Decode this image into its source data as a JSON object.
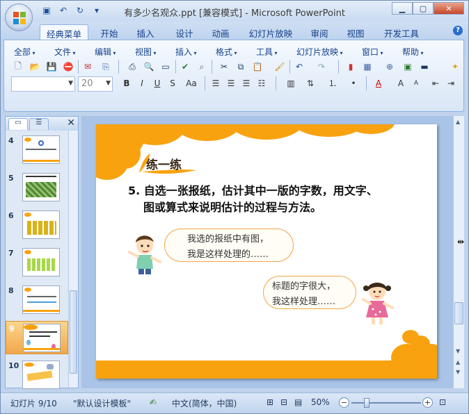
{
  "window": {
    "title": "有多少名观众.ppt [兼容模式] - Microsoft PowerPoint"
  },
  "ribbon_tabs": [
    "经典菜单",
    "开始",
    "插入",
    "设计",
    "动画",
    "幻灯片放映",
    "审阅",
    "视图",
    "开发工具"
  ],
  "menus": [
    "全部",
    "文件",
    "编辑",
    "视图",
    "插入",
    "格式",
    "工具",
    "幻灯片放映",
    "窗口",
    "帮助"
  ],
  "font": {
    "name_value": "",
    "size_value": "20"
  },
  "slides_pane": {
    "slides": [
      {
        "num": "4",
        "selected": false
      },
      {
        "num": "5",
        "selected": false
      },
      {
        "num": "6",
        "selected": false
      },
      {
        "num": "7",
        "selected": false
      },
      {
        "num": "8",
        "selected": false
      },
      {
        "num": "9",
        "selected": true
      },
      {
        "num": "10",
        "selected": false
      }
    ]
  },
  "slide": {
    "heading": "练一练",
    "question_line1": "5. 自选一张报纸，估计其中一版的字数，用文字、",
    "question_line2": "图或算式来说明估计的过程与方法。",
    "bubble1_line1": "我选的报纸中有图，",
    "bubble1_line2": "我是这样处理的……",
    "bubble2_line1": "标题的字很大，",
    "bubble2_line2": "我这样处理……"
  },
  "status": {
    "slide_pos": "幻灯片 9/10",
    "template": "\"默认设计模板\"",
    "language": "中文(简体，中国)",
    "zoom": "50%"
  },
  "colors": {
    "accent_orange": "#f9a20f",
    "ribbon_blue": "#15428b"
  }
}
